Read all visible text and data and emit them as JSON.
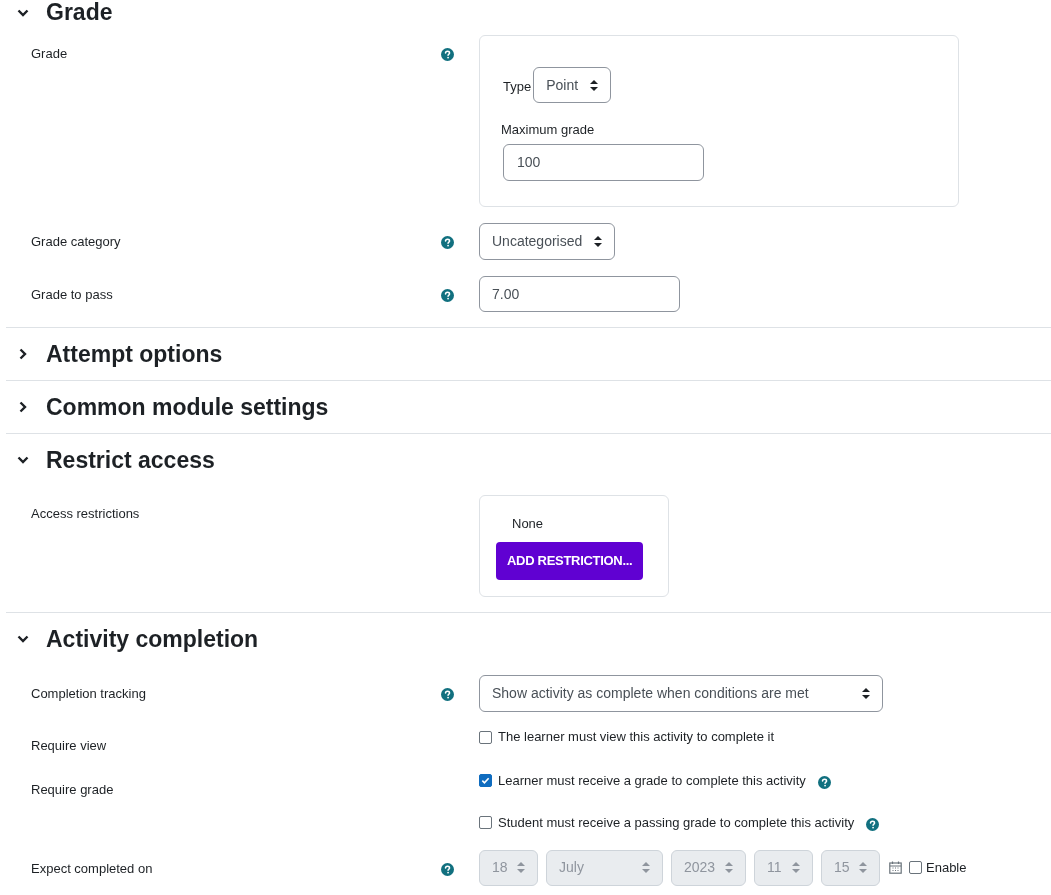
{
  "sections": [
    {
      "title": "Grade",
      "expanded": true,
      "rows": [
        {
          "kind": "grade_box",
          "label": "Grade",
          "help": true,
          "type_label": "Type",
          "type_value": "Point",
          "max_label": "Maximum grade",
          "max_value": "100"
        },
        {
          "kind": "select",
          "label": "Grade category",
          "help": true,
          "value": "Uncategorised"
        },
        {
          "kind": "text",
          "label": "Grade to pass",
          "help": true,
          "value": "7.00"
        }
      ]
    },
    {
      "title": "Attempt options",
      "expanded": false
    },
    {
      "title": "Common module settings",
      "expanded": false
    },
    {
      "title": "Restrict access",
      "expanded": true,
      "rows": [
        {
          "kind": "restrictions",
          "label": "Access restrictions",
          "help": false,
          "none_text": "None",
          "button": "ADD RESTRICTION..."
        }
      ]
    },
    {
      "title": "Activity completion",
      "expanded": true,
      "rows": [
        {
          "kind": "select_wide",
          "label": "Completion tracking",
          "help": true,
          "value": "Show activity as complete when conditions are met"
        },
        {
          "kind": "checkboxes",
          "label": "Require view",
          "help": false,
          "options": [
            {
              "text": "The learner must view this activity to complete it",
              "checked": false,
              "help": false
            }
          ]
        },
        {
          "kind": "checkboxes",
          "label": "Require grade",
          "help": false,
          "options": [
            {
              "text": "Learner must receive a grade to complete this activity",
              "checked": true,
              "help": true
            },
            {
              "text": "Student must receive a passing grade to complete this activity",
              "checked": false,
              "help": true
            }
          ]
        },
        {
          "kind": "date",
          "label": "Expect completed on",
          "help": true,
          "disabled": true,
          "parts": [
            {
              "value": "18"
            },
            {
              "value": "July"
            },
            {
              "value": "2023"
            },
            {
              "value": "11"
            },
            {
              "value": "15"
            }
          ],
          "enable": {
            "text": "Enable",
            "checked": false
          }
        }
      ]
    }
  ]
}
